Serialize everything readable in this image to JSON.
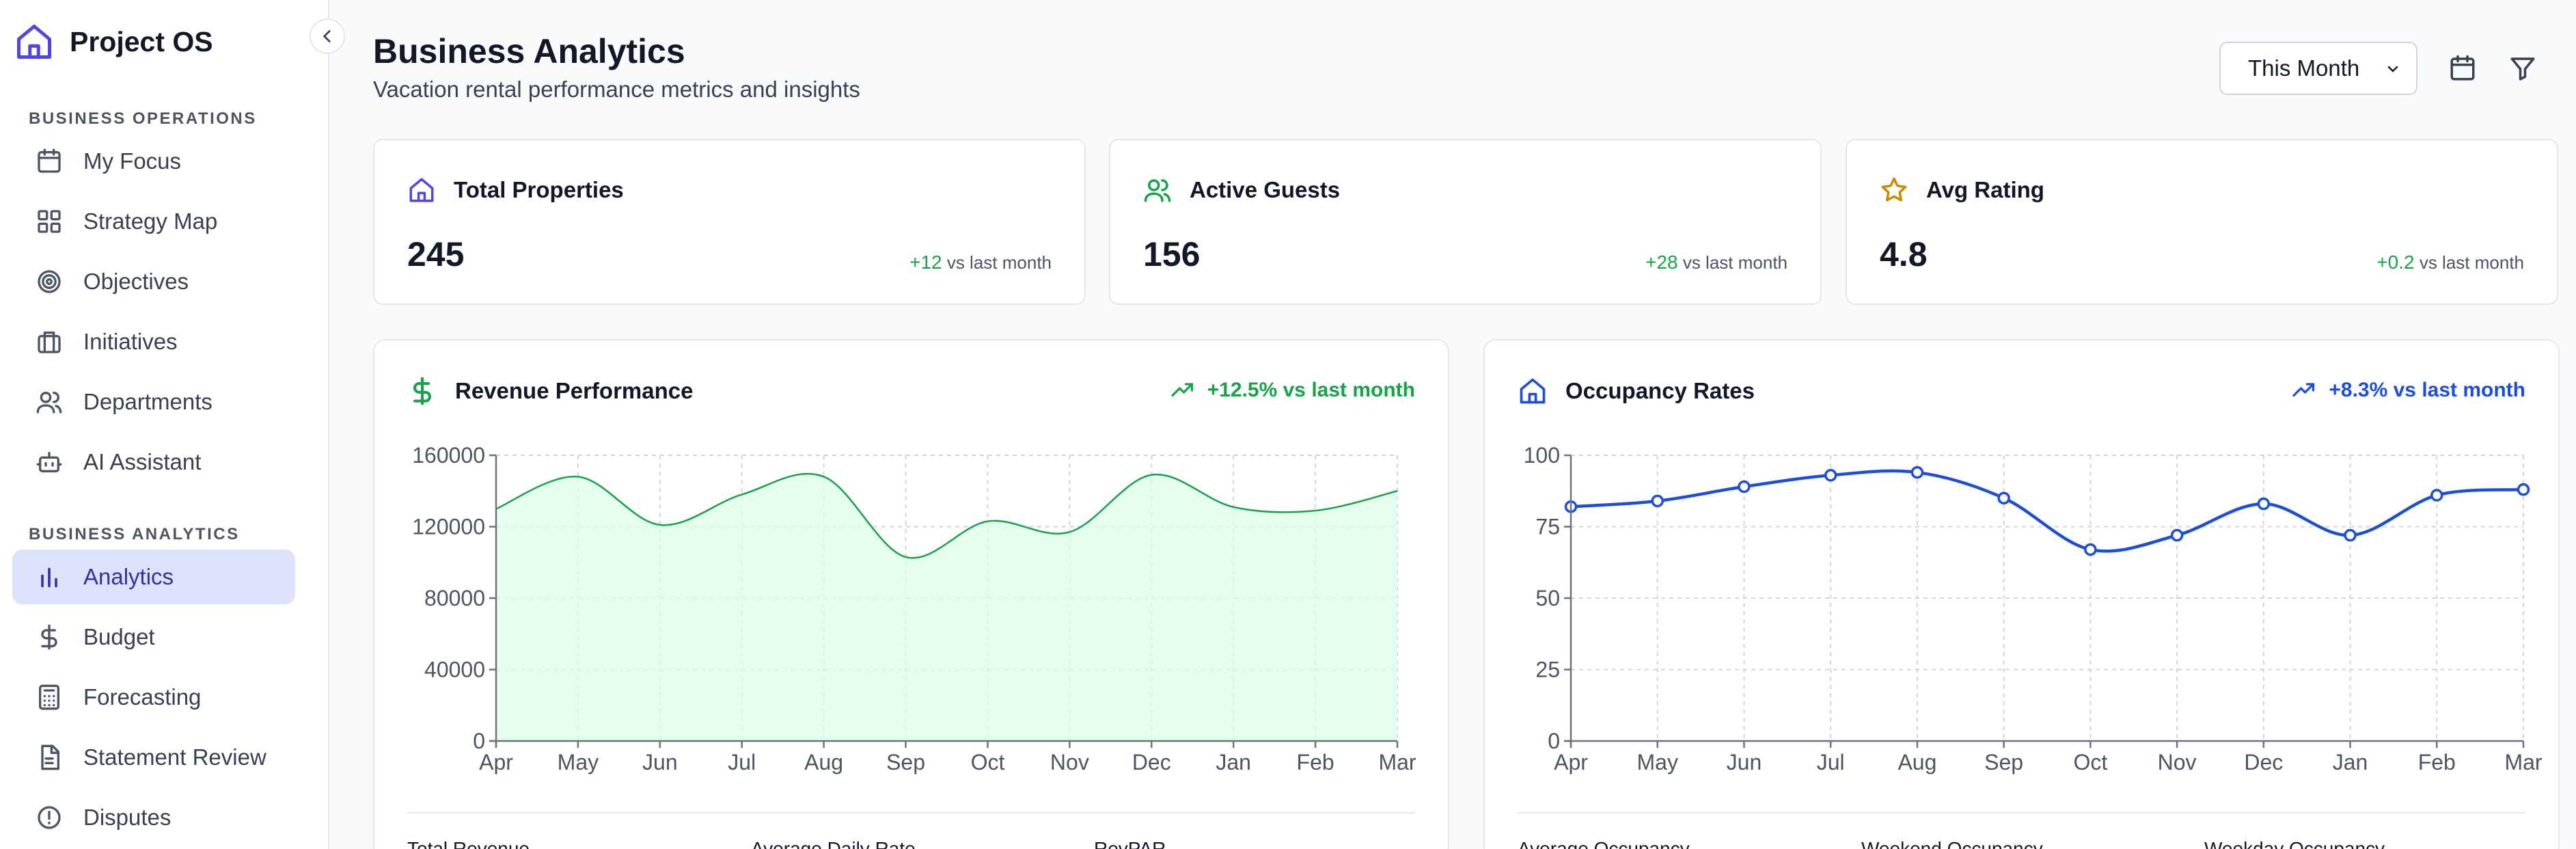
{
  "sidebar": {
    "brand": "Project OS",
    "sections": [
      {
        "title": "Business Operations",
        "items": [
          {
            "label": "My Focus",
            "icon": "calendar-icon"
          },
          {
            "label": "Strategy Map",
            "icon": "grid-icon"
          },
          {
            "label": "Objectives",
            "icon": "target-icon"
          },
          {
            "label": "Initiatives",
            "icon": "briefcase-icon"
          },
          {
            "label": "Departments",
            "icon": "users-icon"
          },
          {
            "label": "AI Assistant",
            "icon": "bot-icon"
          }
        ]
      },
      {
        "title": "Business Analytics",
        "items": [
          {
            "label": "Analytics",
            "icon": "bar-chart-icon",
            "active": true
          },
          {
            "label": "Budget",
            "icon": "dollar-icon"
          },
          {
            "label": "Forecasting",
            "icon": "calculator-icon"
          },
          {
            "label": "Statement Review",
            "icon": "file-text-icon"
          },
          {
            "label": "Disputes",
            "icon": "alert-circle-icon"
          }
        ]
      }
    ]
  },
  "header": {
    "title": "Business Analytics",
    "subtitle": "Vacation rental performance metrics and insights",
    "period": "This Month"
  },
  "stats": [
    {
      "label": "Total Properties",
      "value": "245",
      "delta": "+12",
      "delta_suffix": "vs last month",
      "icon": "home-icon",
      "color": "#4f46e5"
    },
    {
      "label": "Active Guests",
      "value": "156",
      "delta": "+28",
      "delta_suffix": "vs last month",
      "icon": "users-icon",
      "color": "#16a34a"
    },
    {
      "label": "Avg Rating",
      "value": "4.8",
      "delta": "+0.2",
      "delta_suffix": "vs last month",
      "icon": "star-icon",
      "color": "#ca8a04"
    }
  ],
  "revenue": {
    "title": "Revenue Performance",
    "trend": "+12.5% vs last month",
    "metrics": [
      "Total Revenue",
      "Average Daily Rate",
      "RevPAR"
    ]
  },
  "occupancy": {
    "title": "Occupancy Rates",
    "trend": "+8.3% vs last month",
    "metrics": [
      "Average Occupancy",
      "Weekend Occupancy",
      "Weekday Occupancy"
    ]
  },
  "colors": {
    "accent": "#4f46e5",
    "green": "#16a34a",
    "blue": "#1d4ed8",
    "active_bg": "#dde3fb"
  },
  "chart_data": [
    {
      "type": "area",
      "categories": [
        "Apr",
        "May",
        "Jun",
        "Jul",
        "Aug",
        "Sep",
        "Oct",
        "Nov",
        "Dec",
        "Jan",
        "Feb",
        "Mar"
      ],
      "values": [
        130000,
        148000,
        121000,
        138000,
        148000,
        103000,
        123000,
        117000,
        149000,
        131000,
        129000,
        140000
      ],
      "ylim": [
        0,
        160000
      ],
      "yticks": [
        0,
        40000,
        80000,
        120000,
        160000
      ],
      "grid": true,
      "color": "#16a34a"
    },
    {
      "type": "line",
      "categories": [
        "Apr",
        "May",
        "Jun",
        "Jul",
        "Aug",
        "Sep",
        "Oct",
        "Nov",
        "Dec",
        "Jan",
        "Feb",
        "Mar"
      ],
      "values": [
        82,
        84,
        89,
        93,
        94,
        85,
        67,
        72,
        83,
        72,
        86,
        88
      ],
      "ylim": [
        0,
        100
      ],
      "yticks": [
        0,
        25,
        50,
        75,
        100
      ],
      "grid": true,
      "color": "#1d4ed8"
    }
  ]
}
